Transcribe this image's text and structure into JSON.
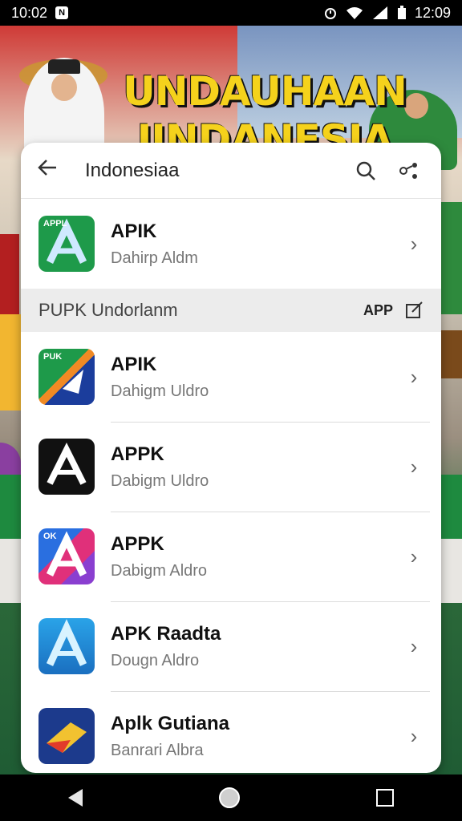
{
  "status": {
    "time_left": "10:02",
    "notification": "N",
    "time_right": "12:09"
  },
  "banner": {
    "line1": "UNDAUHAAN",
    "line2": "IINDANESIA"
  },
  "toolbar": {
    "title": "Indonesiaa"
  },
  "top_item": {
    "tag": "APPL",
    "name": "APIK",
    "subtitle": "Dahirp Aldm"
  },
  "section": {
    "label": "PUPK Undorlanm",
    "app_label": "APP"
  },
  "items": [
    {
      "tag": "PUK",
      "name": "APIK",
      "subtitle": "Dahigm Uldro"
    },
    {
      "tag": "",
      "name": "APPK",
      "subtitle": "Dabigm Uldro"
    },
    {
      "tag": "OK",
      "name": "APPK",
      "subtitle": "Dabigm Aldro"
    },
    {
      "tag": "",
      "name": "APK Raadta",
      "subtitle": "Dougn Aldro"
    },
    {
      "tag": "",
      "name": "Aplk Gutiana",
      "subtitle": "Banrari Albra"
    }
  ],
  "colors": {
    "accent": "#f5d21c",
    "card": "#ffffff"
  }
}
